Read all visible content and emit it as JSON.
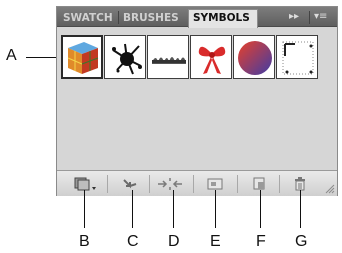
{
  "panel": {
    "tabs": [
      {
        "label": "SWATCH",
        "active": false
      },
      {
        "label": "BRUSHES",
        "active": false
      },
      {
        "label": "SYMBOLS",
        "active": true
      }
    ],
    "collapse_glyph": "▸▸",
    "menu_glyph": "▾≡"
  },
  "symbols": [
    {
      "name": "cube-symbol",
      "icon": "colored-cube"
    },
    {
      "name": "splat-symbol",
      "icon": "ink-splat"
    },
    {
      "name": "grass-symbol",
      "icon": "grass-tuft"
    },
    {
      "name": "bow-symbol",
      "icon": "red-ribbon-bow"
    },
    {
      "name": "sphere-symbol",
      "icon": "gradient-sphere"
    },
    {
      "name": "frame-symbol",
      "icon": "corner-frame"
    }
  ],
  "toolbar": {
    "buttons": [
      {
        "name": "symbol-libraries-menu-button",
        "icon": "library-icon"
      },
      {
        "name": "place-symbol-instance-button",
        "icon": "place-arrow-icon"
      },
      {
        "name": "break-link-button",
        "icon": "break-link-icon"
      },
      {
        "name": "symbol-options-button",
        "icon": "options-icon"
      },
      {
        "name": "new-symbol-button",
        "icon": "new-item-icon"
      },
      {
        "name": "delete-symbol-button",
        "icon": "trash-icon"
      }
    ]
  },
  "callouts": {
    "a": "A",
    "b": "B",
    "c": "C",
    "d": "D",
    "e": "E",
    "f": "F",
    "g": "G"
  },
  "colors": {
    "tabbar": "#6e6e6e",
    "panel_bg": "#d6d6d6",
    "bow_red": "#d92b2b",
    "sphere_red": "#d9342b",
    "sphere_blue": "#3f3ca6"
  }
}
